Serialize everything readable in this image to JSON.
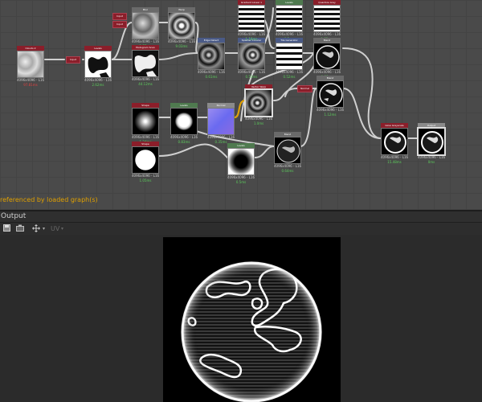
{
  "graph": {
    "status_text": "referenced by loaded graph(s)",
    "nodes": {
      "source": {
        "title": "Clouds 2",
        "res": "4096x4096 - L16",
        "time": "97.81ms"
      },
      "levels": {
        "title": "Levels",
        "res": "4096x4096 - L16",
        "time": "2.62ms"
      },
      "blur": {
        "title": "Blur",
        "res": "4096x4096 - L16",
        "time": "2.77ms"
      },
      "warp": {
        "title": "Warp",
        "res": "4096x4096 - L16",
        "time": "9.03ms"
      },
      "histo": {
        "title": "Histogram Scan",
        "res": "4096x4096 - L16",
        "time": "44.12ms"
      },
      "edge": {
        "title": "Edge Detect",
        "res": "4096x4096 - L16",
        "time": "0.61ms"
      },
      "splatter": {
        "title": "Splatter Circular",
        "res": "4096x4096 - L16",
        "time": "0.53ms"
      },
      "grad": {
        "title": "Gradient Linear 1",
        "res": "4096x4096 - L16",
        "time": "1.18ms"
      },
      "lines": {
        "title": "Levels",
        "res": "4096x4096 - L16",
        "time": "0.5ms"
      },
      "tile": {
        "title": "Tile Generator",
        "res": "4096x4096 - L16",
        "time": "0.52ms"
      },
      "quantize": {
        "title": "Quantize Gray",
        "res": "4096x4096 - L16",
        "time": "1.82ms"
      },
      "blend1": {
        "title": "Blend",
        "res": "4096x4096 - L16",
        "time": "0.66ms"
      },
      "shape1": {
        "title": "Shape",
        "res": "4096x4096 - L16",
        "time": "1.34ms"
      },
      "circle": {
        "title": "Levels",
        "res": "4096x4096 - L16",
        "time": "0.83ms"
      },
      "normal": {
        "title": "Normal",
        "res": "4096x4096 - L16",
        "time": "0.35ms"
      },
      "vector": {
        "title": "Vector Warp",
        "res": "4096x4096 - L16",
        "time": "1.0ms"
      },
      "shape2": {
        "title": "Shape",
        "res": "4096x4096 - L16",
        "time": "1.05ms"
      },
      "vignette": {
        "title": "Levels",
        "res": "4096x4096 - L16",
        "time": "0.5ms"
      },
      "blend2": {
        "title": "Blend",
        "res": "4096x4096 - L16",
        "time": "0.64ms"
      },
      "mask": {
        "title": "Blend",
        "res": "4096x4096 - L16",
        "time": "1.12ms"
      },
      "glow": {
        "title": "Glow Grayscale",
        "res": "4096x4096 - L16",
        "time": "15.48ms"
      },
      "output": {
        "title": "Output",
        "res": "4096x4096 - L16",
        "time": "0ms"
      }
    },
    "chips": {
      "in1": "Input",
      "in2": "Input",
      "seed": "Input",
      "mask": "Normal"
    }
  },
  "output_panel": {
    "title": "Output",
    "toolbar": {
      "save_icon": "save-icon",
      "copy_icon": "copy-icon",
      "transform_icon": "move-icon",
      "channel_label": "UV"
    }
  },
  "colors": {
    "accent_green": "#5ccc5c",
    "status_orange": "#e0a000",
    "header_red": "#8b1e2a"
  }
}
